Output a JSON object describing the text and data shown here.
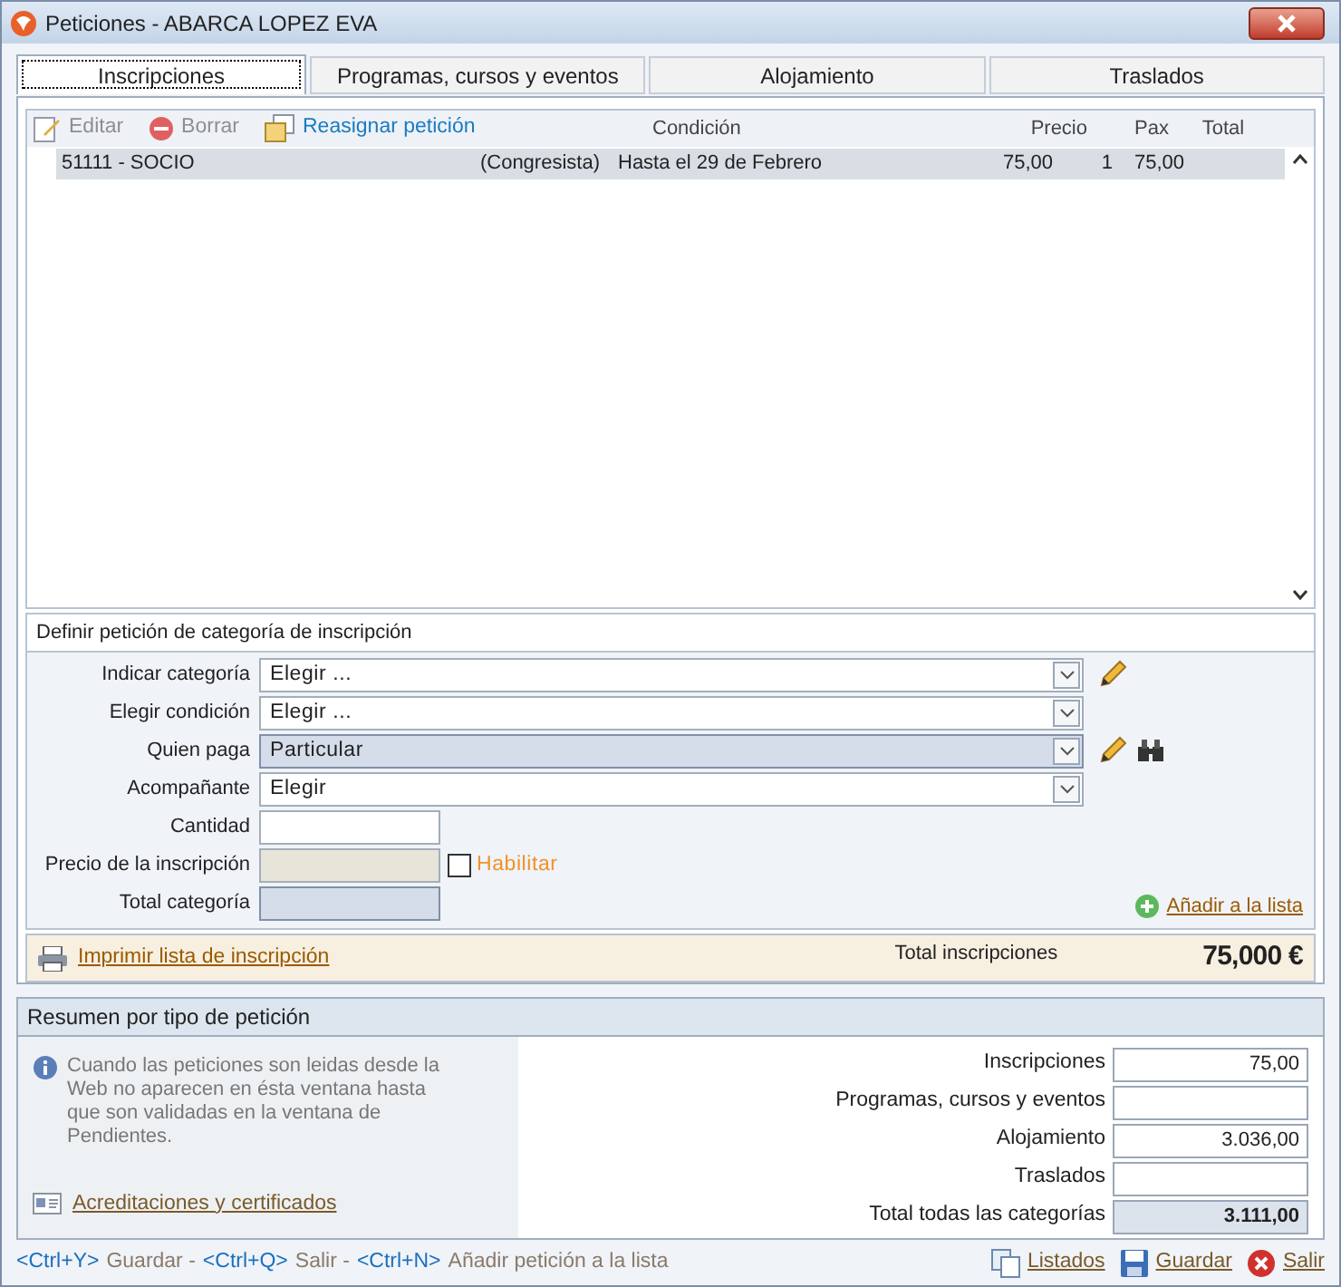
{
  "window": {
    "title": "Peticiones - ABARCA LOPEZ EVA"
  },
  "tabs": [
    {
      "label": "Inscripciones",
      "selected": true
    },
    {
      "label": "Programas, cursos y eventos",
      "selected": false
    },
    {
      "label": "Alojamiento",
      "selected": false
    },
    {
      "label": "Traslados",
      "selected": false
    }
  ],
  "grid": {
    "toolbar": [
      {
        "label": "Editar",
        "disabled": true,
        "kind": "edit"
      },
      {
        "label": "Borrar",
        "disabled": true,
        "kind": "delete"
      },
      {
        "label": "Reasignar petición",
        "disabled": false,
        "kind": "reassign"
      }
    ],
    "columns": [
      "Condición",
      "Precio",
      "Pax",
      "Total"
    ],
    "rows": [
      {
        "category": "51111 - SOCIO",
        "type": "(Congresista)",
        "condition": "Hasta el 29 de Febrero",
        "price": "75,00",
        "pax": "1",
        "total": "75,00",
        "selected": true
      }
    ]
  },
  "form": {
    "title": "Definir petición de categoría de inscripción",
    "fields": [
      {
        "label": "Indicar categoría",
        "kind": "select",
        "value": "Elegir ...",
        "readonly": false,
        "disabled": false,
        "buttons": [
          {
            "kind": "edit"
          }
        ]
      },
      {
        "label": "Elegir condición",
        "kind": "select",
        "value": "Elegir ...",
        "readonly": false,
        "disabled": false
      },
      {
        "label": "Quien paga",
        "kind": "select",
        "value": "Particular",
        "readonly": true,
        "disabled": false,
        "buttons": [
          {
            "kind": "edit"
          },
          {
            "kind": "search"
          }
        ]
      },
      {
        "label": "Acompañante",
        "kind": "select",
        "value": "Elegir",
        "readonly": false,
        "disabled": false
      },
      {
        "label": "Cantidad",
        "kind": "input",
        "readonly": false,
        "disabled": false
      },
      {
        "label": "Precio de la inscripción",
        "kind": "input",
        "readonly": false,
        "disabled": true,
        "checkbox": {
          "label": "Habilitar",
          "checked": false
        }
      },
      {
        "label": "Total categoría",
        "kind": "input",
        "readonly": true,
        "disabled": false
      }
    ],
    "add_link": "Añadir a la lista"
  },
  "totals_bar": {
    "print_link": "Imprimir lista de inscripción",
    "label": "Total inscripciones",
    "value": "75,000 €"
  },
  "summary": {
    "title": "Resumen por tipo de petición",
    "info": "Cuando las peticiones son leidas desde la Web no aparecen en ésta ventana hasta que son validadas en la ventana de Pendientes.",
    "link": "Acreditaciones y certificados",
    "rows": [
      {
        "label": "Inscripciones",
        "value": "75,00",
        "total": false
      },
      {
        "label": "Programas, cursos y eventos",
        "total": false
      },
      {
        "label": "Alojamiento",
        "value": "3.036,00",
        "total": false
      },
      {
        "label": "Traslados",
        "total": false
      },
      {
        "label": "Total todas las categorías",
        "value": "3.111,00",
        "total": true
      }
    ]
  },
  "footer": {
    "shortcuts": [
      {
        "key": "<Ctrl+Y>",
        "action": "Guardar -"
      },
      {
        "key": "<Ctrl+Q>",
        "action": "Salir -"
      },
      {
        "key": "<Ctrl+N>",
        "action": "Añadir petición a la lista"
      }
    ],
    "buttons": [
      {
        "label": "Listados",
        "kind": "list"
      },
      {
        "label": "Guardar",
        "kind": "save"
      },
      {
        "label": "Salir",
        "kind": "exit"
      }
    ]
  }
}
